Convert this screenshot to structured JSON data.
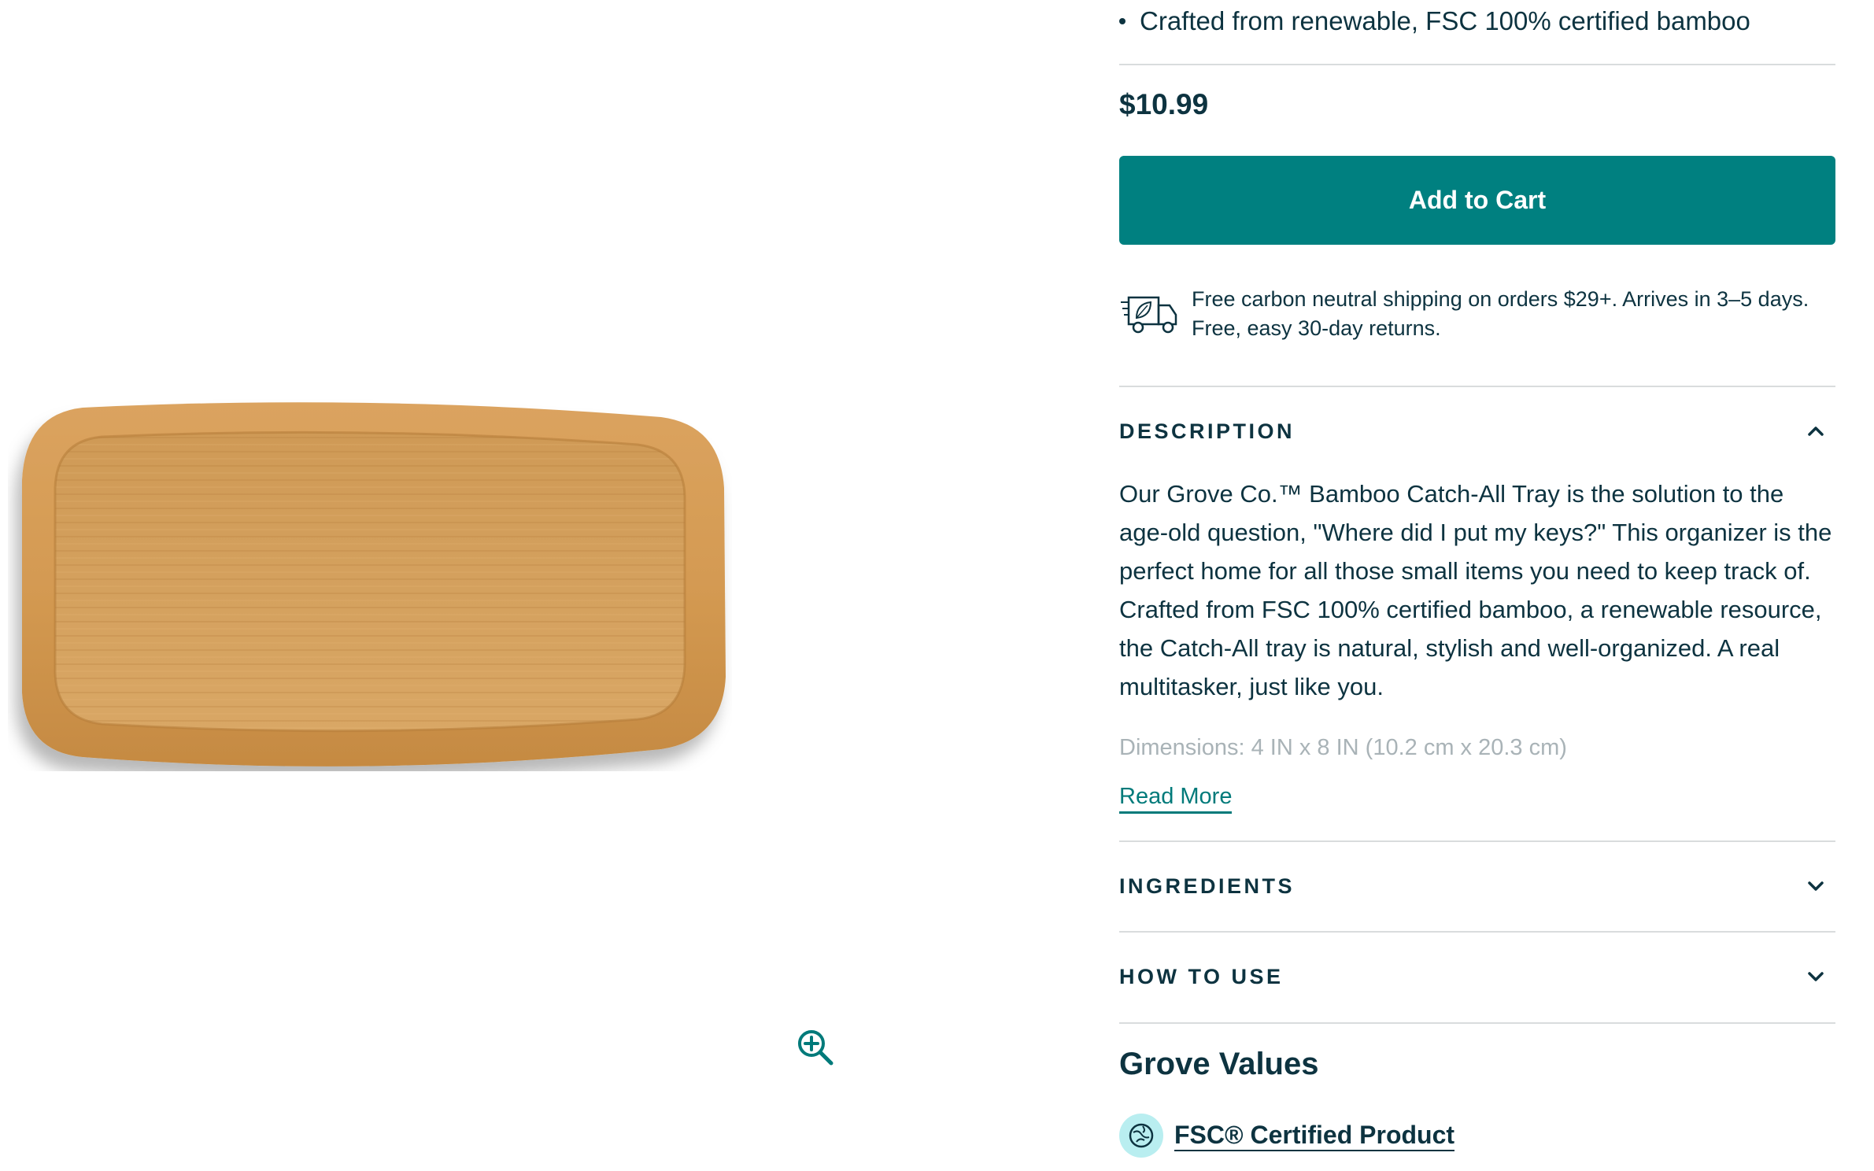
{
  "product": {
    "feature_bullet": "Crafted from renewable, FSC 100% certified bamboo",
    "price": "$10.99",
    "add_to_cart_label": "Add to Cart",
    "shipping_text": "Free carbon neutral shipping on orders $29+. Arrives in 3–5 days. Free, easy 30-day returns.",
    "image_icon": "zoom-in-icon"
  },
  "accordion": {
    "description": {
      "label": "DESCRIPTION",
      "expanded": true,
      "body": "Our Grove Co.™ Bamboo Catch-All Tray is the solution to the age-old question, \"Where did I put my keys?\" This organizer is the perfect home for all those small items you need to keep track of. Crafted from FSC 100% certified bamboo, a renewable resource, the Catch-All tray is natural, stylish and well-organized. A real multitasker, just like you.",
      "dimensions": "Dimensions: 4 IN x 8 IN (10.2 cm x 20.3 cm)",
      "read_more": "Read More"
    },
    "ingredients": {
      "label": "INGREDIENTS",
      "expanded": false
    },
    "how_to_use": {
      "label": "HOW TO USE",
      "expanded": false
    }
  },
  "grove_values": {
    "title": "Grove Values",
    "items": [
      {
        "label": "FSC® Certified Product",
        "icon": "globe-leaf-icon"
      }
    ]
  },
  "colors": {
    "accent": "#008080",
    "text": "#0d3340",
    "divider": "#d9dcdd",
    "badge": "#b9eef0",
    "muted": "#a9b3b7"
  }
}
